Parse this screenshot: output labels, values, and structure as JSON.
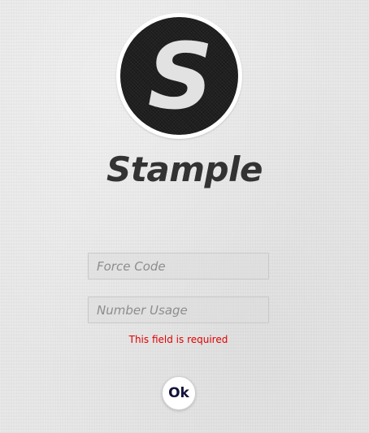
{
  "brand": {
    "title": "Stample",
    "logo_letter": "S",
    "logo_icon": "stample-logo-icon"
  },
  "form": {
    "force_code": {
      "value": "",
      "placeholder": "Force Code"
    },
    "number_usage": {
      "value": "",
      "placeholder": "Number Usage",
      "error": "This field is required"
    },
    "ok_label": "Ok"
  },
  "colors": {
    "background": "#e6e6e6",
    "logo_circle": "#1b1b1b",
    "logo_letter": "#e2e2e2",
    "title": "#333333",
    "error": "#e10000",
    "button_text": "#12123a"
  }
}
